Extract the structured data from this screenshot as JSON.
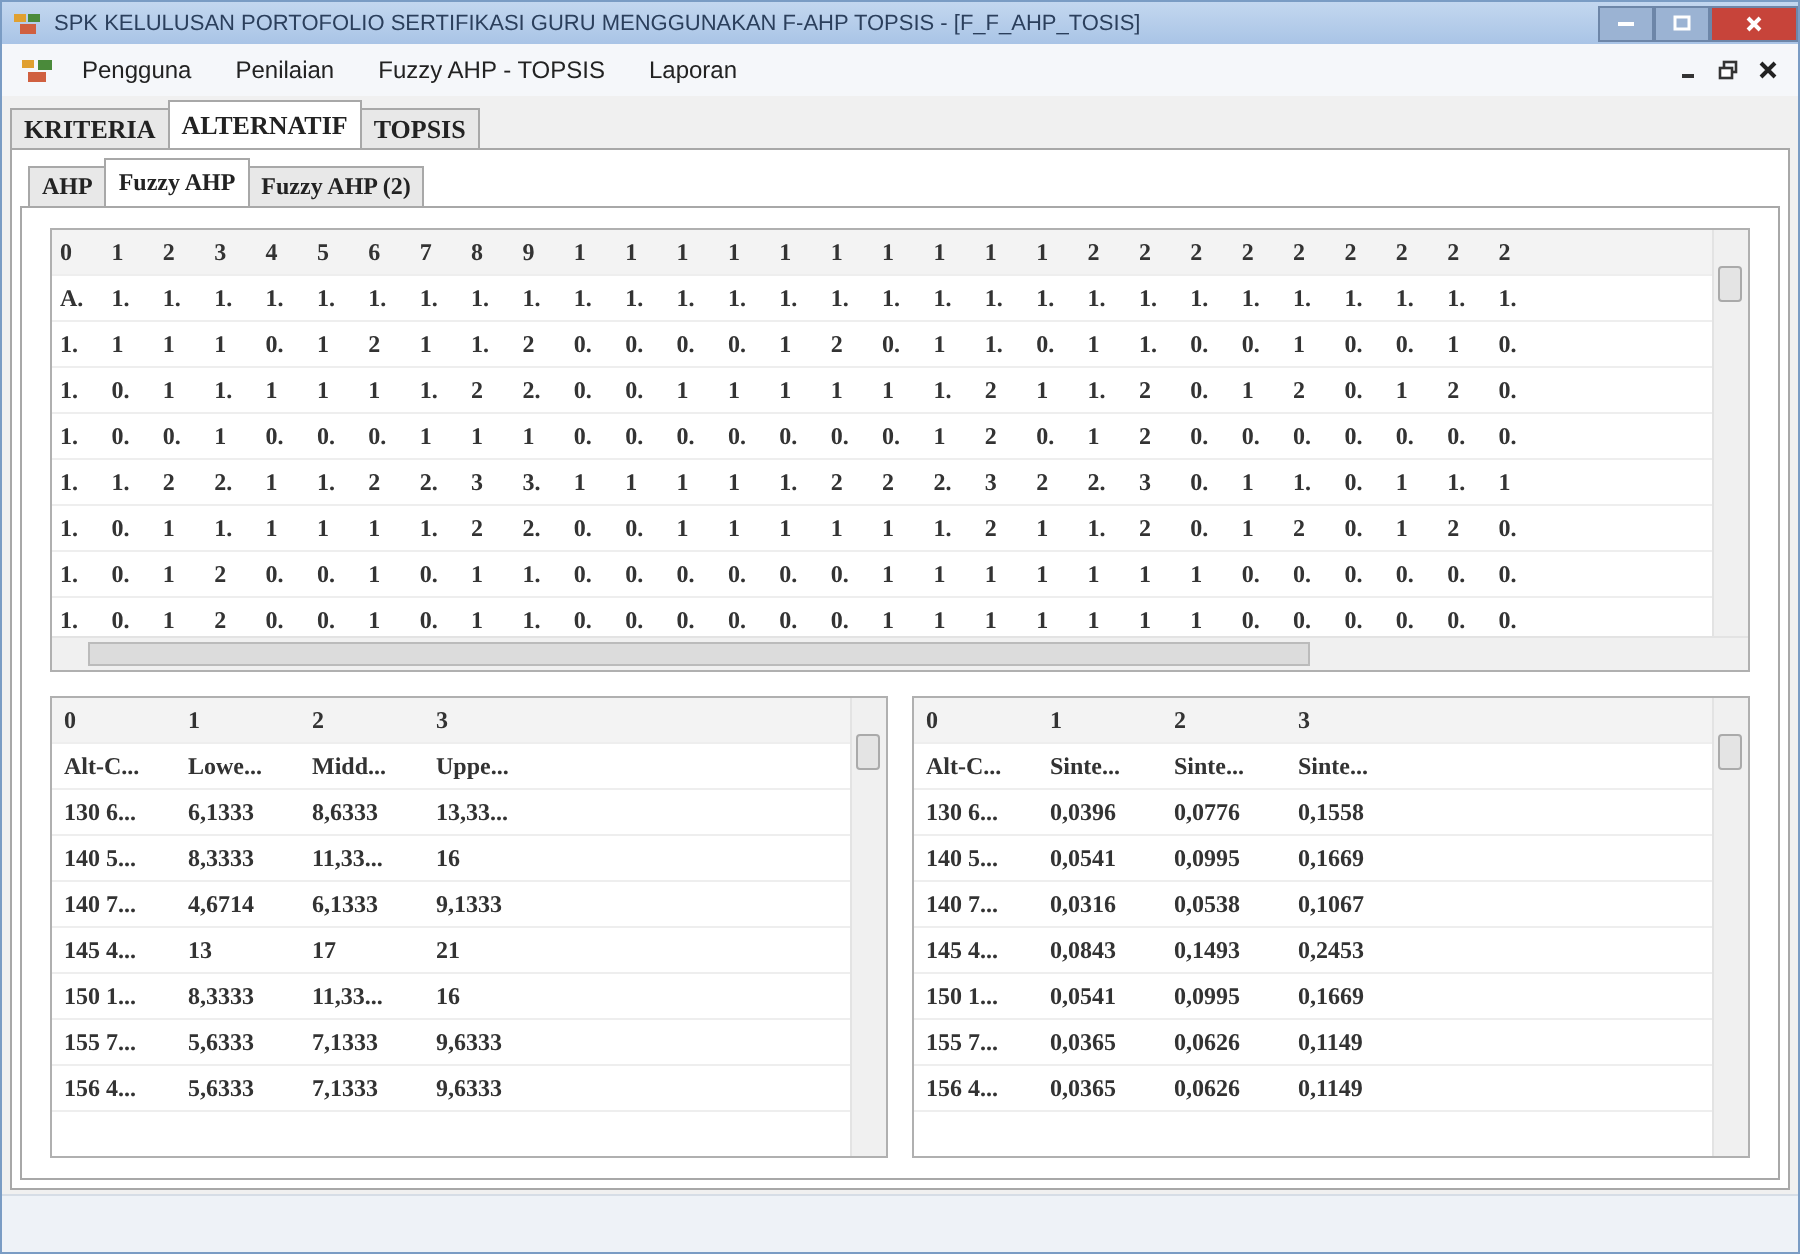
{
  "window": {
    "title": "SPK KELULUSAN PORTOFOLIO SERTIFIKASI GURU MENGGUNAKAN F-AHP TOPSIS - [F_F_AHP_TOSIS]"
  },
  "menu": [
    "Pengguna",
    "Penilaian",
    "Fuzzy AHP - TOPSIS",
    "Laporan"
  ],
  "main_tabs": [
    {
      "label": "KRITERIA",
      "selected": false
    },
    {
      "label": "ALTERNATIF",
      "selected": true
    },
    {
      "label": "TOPSIS",
      "selected": false
    }
  ],
  "sub_tabs": [
    {
      "label": "AHP",
      "selected": false
    },
    {
      "label": "Fuzzy AHP",
      "selected": true
    },
    {
      "label": "Fuzzy AHP (2)",
      "selected": false
    }
  ],
  "matrix": {
    "columns": [
      "0",
      "1",
      "2",
      "3",
      "4",
      "5",
      "6",
      "7",
      "8",
      "9",
      "1",
      "1",
      "1",
      "1",
      "1",
      "1",
      "1",
      "1",
      "1",
      "1",
      "2",
      "2",
      "2",
      "2",
      "2",
      "2",
      "2",
      "2",
      "2"
    ],
    "rows": [
      [
        "A.",
        "1.",
        "1.",
        "1.",
        "1.",
        "1.",
        "1.",
        "1.",
        "1.",
        "1.",
        "1.",
        "1.",
        "1.",
        "1.",
        "1.",
        "1.",
        "1.",
        "1.",
        "1.",
        "1.",
        "1.",
        "1.",
        "1.",
        "1.",
        "1.",
        "1.",
        "1.",
        "1.",
        "1."
      ],
      [
        "1.",
        "1",
        "1",
        "1",
        "0.",
        "1",
        "2",
        "1",
        "1.",
        "2",
        "0.",
        "0.",
        "0.",
        "0.",
        "1",
        "2",
        "0.",
        "1",
        "1.",
        "0.",
        "1",
        "1.",
        "0.",
        "0.",
        "1",
        "0.",
        "0.",
        "1",
        "0."
      ],
      [
        "1.",
        "0.",
        "1",
        "1.",
        "1",
        "1",
        "1",
        "1.",
        "2",
        "2.",
        "0.",
        "0.",
        "1",
        "1",
        "1",
        "1",
        "1",
        "1.",
        "2",
        "1",
        "1.",
        "2",
        "0.",
        "1",
        "2",
        "0.",
        "1",
        "2",
        "0."
      ],
      [
        "1.",
        "0.",
        "0.",
        "1",
        "0.",
        "0.",
        "0.",
        "1",
        "1",
        "1",
        "0.",
        "0.",
        "0.",
        "0.",
        "0.",
        "0.",
        "0.",
        "1",
        "2",
        "0.",
        "1",
        "2",
        "0.",
        "0.",
        "0.",
        "0.",
        "0.",
        "0.",
        "0."
      ],
      [
        "1.",
        "1.",
        "2",
        "2.",
        "1",
        "1.",
        "2",
        "2.",
        "3",
        "3.",
        "1",
        "1",
        "1",
        "1",
        "1.",
        "2",
        "2",
        "2.",
        "3",
        "2",
        "2.",
        "3",
        "0.",
        "1",
        "1.",
        "0.",
        "1",
        "1.",
        "1"
      ],
      [
        "1.",
        "0.",
        "1",
        "1.",
        "1",
        "1",
        "1",
        "1.",
        "2",
        "2.",
        "0.",
        "0.",
        "1",
        "1",
        "1",
        "1",
        "1",
        "1.",
        "2",
        "1",
        "1.",
        "2",
        "0.",
        "1",
        "2",
        "0.",
        "1",
        "2",
        "0."
      ],
      [
        "1.",
        "0.",
        "1",
        "2",
        "0.",
        "0.",
        "1",
        "0.",
        "1",
        "1.",
        "0.",
        "0.",
        "0.",
        "0.",
        "0.",
        "0.",
        "1",
        "1",
        "1",
        "1",
        "1",
        "1",
        "1",
        "0.",
        "0.",
        "0.",
        "0.",
        "0.",
        "0."
      ],
      [
        "1.",
        "0.",
        "1",
        "2",
        "0.",
        "0.",
        "1",
        "0.",
        "1",
        "1.",
        "0.",
        "0.",
        "0.",
        "0.",
        "0.",
        "0.",
        "1",
        "1",
        "1",
        "1",
        "1",
        "1",
        "1",
        "0.",
        "0.",
        "0.",
        "0.",
        "0.",
        "0."
      ]
    ]
  },
  "fuzzy_table": {
    "columns": [
      "0",
      "1",
      "2",
      "3"
    ],
    "rows": [
      [
        "Alt-C...",
        "Lowe...",
        "Midd...",
        "Uppe..."
      ],
      [
        "130 6...",
        "6,1333",
        "8,6333",
        "13,33..."
      ],
      [
        "140 5...",
        "8,3333",
        "11,33...",
        "16"
      ],
      [
        "140 7...",
        "4,6714",
        "6,1333",
        "9,1333"
      ],
      [
        "145 4...",
        "13",
        "17",
        "21"
      ],
      [
        "150 1...",
        "8,3333",
        "11,33...",
        "16"
      ],
      [
        "155 7...",
        "5,6333",
        "7,1333",
        "9,6333"
      ],
      [
        "156 4...",
        "5,6333",
        "7,1333",
        "9,6333"
      ]
    ]
  },
  "synthesis_table": {
    "columns": [
      "0",
      "1",
      "2",
      "3"
    ],
    "rows": [
      [
        "Alt-C...",
        "Sinte...",
        "Sinte...",
        "Sinte..."
      ],
      [
        "130 6...",
        "0,0396",
        "0,0776",
        "0,1558"
      ],
      [
        "140 5...",
        "0,0541",
        "0,0995",
        "0,1669"
      ],
      [
        "140 7...",
        "0,0316",
        "0,0538",
        "0,1067"
      ],
      [
        "145 4...",
        "0,0843",
        "0,1493",
        "0,2453"
      ],
      [
        "150 1...",
        "0,0541",
        "0,0995",
        "0,1669"
      ],
      [
        "155 7...",
        "0,0365",
        "0,0626",
        "0,1149"
      ],
      [
        "156 4...",
        "0,0365",
        "0,0626",
        "0,1149"
      ]
    ]
  }
}
